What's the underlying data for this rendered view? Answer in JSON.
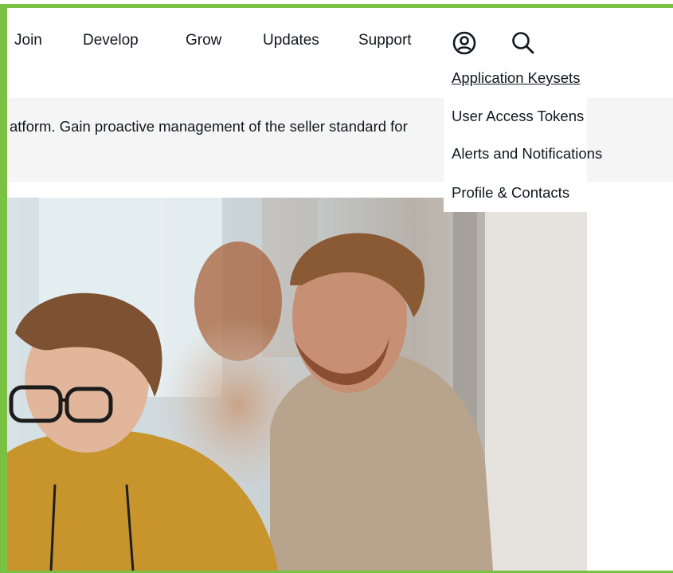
{
  "nav": {
    "items": [
      {
        "label": "Join"
      },
      {
        "label": "Develop"
      },
      {
        "label": "Grow"
      },
      {
        "label": "Updates"
      },
      {
        "label": "Support"
      }
    ],
    "account_icon": "user-circle-icon",
    "search_icon": "search-icon"
  },
  "banner": {
    "text": "atform. Gain proactive management of the seller standard for"
  },
  "account_menu": {
    "items": [
      {
        "label": "Application Keysets"
      },
      {
        "label": "User Access Tokens"
      },
      {
        "label": "Alerts and Notifications"
      },
      {
        "label": "Profile & Contacts"
      }
    ]
  },
  "colors": {
    "highlight_frame": "#7ac143",
    "text": "#111820",
    "banner_bg": "#f5f5f5"
  }
}
